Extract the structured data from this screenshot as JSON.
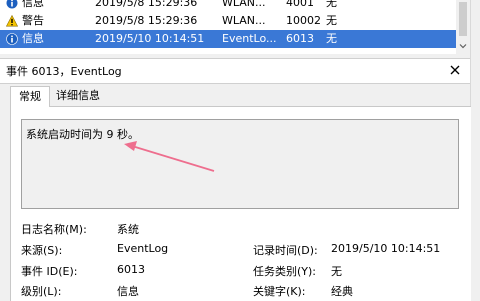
{
  "event_list": {
    "rows": [
      {
        "level": "信息",
        "level_icon": "info-icon",
        "date": "2019/5/8 15:29:36",
        "source": "WLAN...",
        "event_id": "4001",
        "task": "无"
      },
      {
        "level": "警告",
        "level_icon": "warning-icon",
        "date": "2019/5/8 15:29:36",
        "source": "WLAN...",
        "event_id": "10002",
        "task": "无"
      },
      {
        "level": "信息",
        "level_icon": "info-icon",
        "date": "2019/5/10 10:14:51",
        "source": "EventLo...",
        "event_id": "6013",
        "task": "无"
      }
    ],
    "selected_index": 2
  },
  "properties": {
    "title": "事件 6013，EventLog",
    "tabs": [
      {
        "label": "常规"
      },
      {
        "label": "详细信息"
      }
    ],
    "message": "系统启动时间为 9 秒。",
    "fields": {
      "log_name": {
        "label": "日志名称(M):",
        "value": "系统"
      },
      "source": {
        "label": "来源(S):",
        "value": "EventLog"
      },
      "event_id": {
        "label": "事件 ID(E):",
        "value": "6013"
      },
      "level": {
        "label": "级别(L):",
        "value": "信息"
      },
      "logged": {
        "label": "记录时间(D):",
        "value": "2019/5/10 10:14:51"
      },
      "task_category": {
        "label": "任务类别(Y):",
        "value": "无"
      },
      "keywords": {
        "label": "关键字(K):",
        "value": "经典"
      }
    }
  },
  "colors": {
    "selection": "#3a78d6",
    "annotation_arrow": "#ee6e8e"
  }
}
